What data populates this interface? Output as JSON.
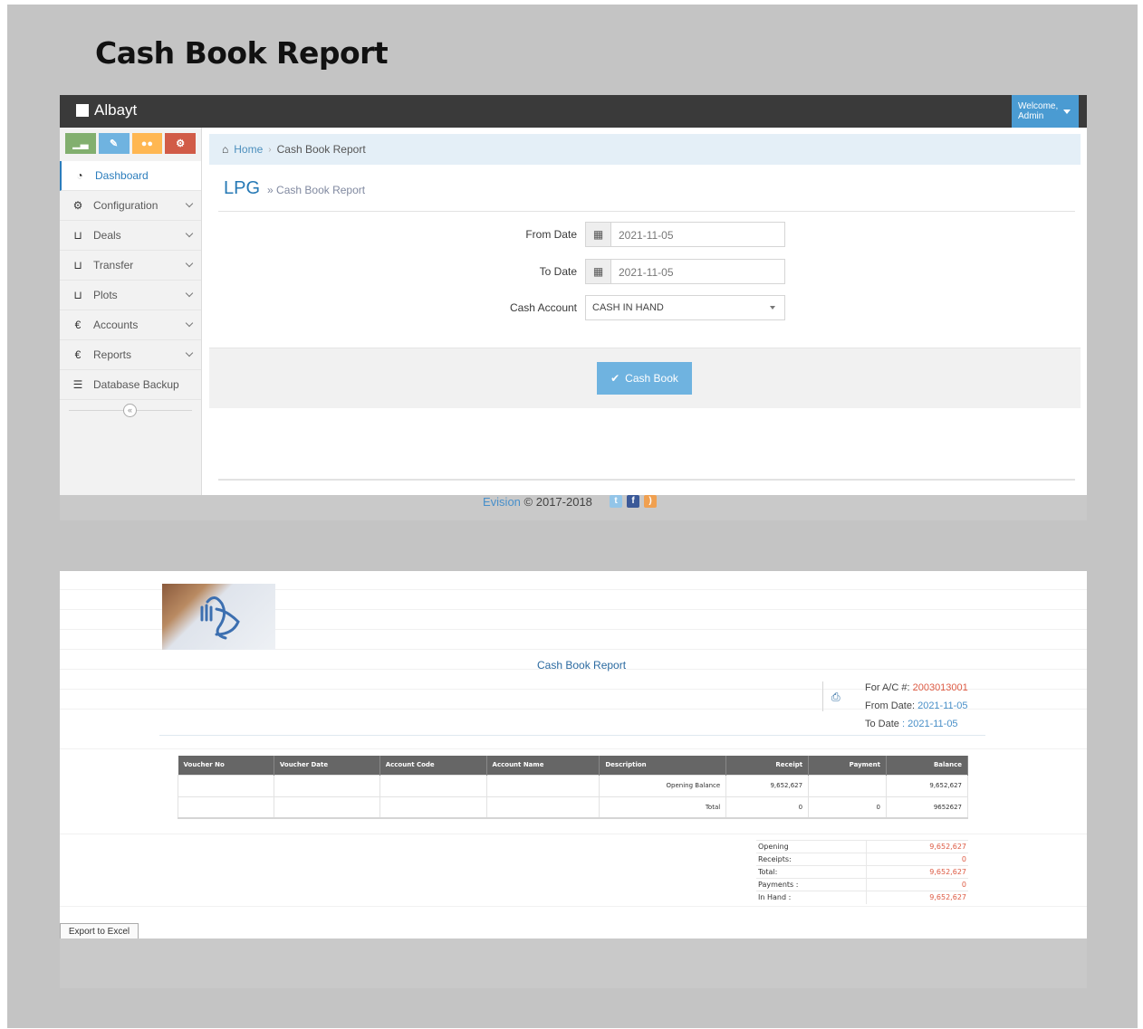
{
  "page": {
    "title": "Cash Book Report"
  },
  "app": {
    "brand": "Albayt",
    "user_menu": {
      "line1": "Welcome,",
      "line2": "Admin"
    }
  },
  "sidebar": {
    "items": [
      {
        "label": "Dashboard",
        "icon": "tachometer-icon"
      },
      {
        "label": "Configuration",
        "icon": "cogs-icon"
      },
      {
        "label": "Deals",
        "icon": "cart-icon"
      },
      {
        "label": "Transfer",
        "icon": "cart-icon"
      },
      {
        "label": "Plots",
        "icon": "cart-icon"
      },
      {
        "label": "Accounts",
        "icon": "euro-icon"
      },
      {
        "label": "Reports",
        "icon": "euro-icon"
      },
      {
        "label": "Database Backup",
        "icon": "database-icon"
      }
    ],
    "collapse_glyph": "«"
  },
  "breadcrumb": {
    "home": "Home",
    "current": "Cash Book Report"
  },
  "section": {
    "title": "LPG",
    "subtitle": "» Cash Book Report"
  },
  "form": {
    "from_date": {
      "label": "From Date",
      "value": "2021-11-05"
    },
    "to_date": {
      "label": "To Date",
      "value": "2021-11-05"
    },
    "cash_account": {
      "label": "Cash Account",
      "value": "CASH IN HAND"
    },
    "submit_label": "Cash Book"
  },
  "footer": {
    "brand": "Evision",
    "copyright": "© 2017-2018"
  },
  "report": {
    "title": "Cash Book Report",
    "account_label": "For A/C #:",
    "account_no": "2003013001",
    "from_label": "From Date:",
    "from_value": "2021-11-05",
    "to_label": "To Date",
    "to_value": ": 2021-11-05",
    "columns": [
      "Voucher No",
      "Voucher Date",
      "Account Code",
      "Account Name",
      "Description",
      "Receipt",
      "Payment",
      "Balance"
    ],
    "rows": [
      [
        "",
        "",
        "",
        "",
        "Opening Balance",
        "9,652,627",
        "",
        "9,652,627"
      ],
      [
        "",
        "",
        "",
        "",
        "Total",
        "0",
        "0",
        "9652627"
      ]
    ],
    "summary": [
      {
        "label": "Opening",
        "value": "9,652,627"
      },
      {
        "label": "Receipts:",
        "value": "0"
      },
      {
        "label": "Total:",
        "value": "9,652,627"
      },
      {
        "label": "Payments :",
        "value": "0"
      },
      {
        "label": "In Hand :",
        "value": "9,652,627"
      }
    ],
    "export_label": "Export to Excel"
  },
  "colors": {
    "accent": "#6fb3e0",
    "navbar": "#3a3a3a",
    "negative": "#dd5a43",
    "link": "#4a90c8"
  }
}
